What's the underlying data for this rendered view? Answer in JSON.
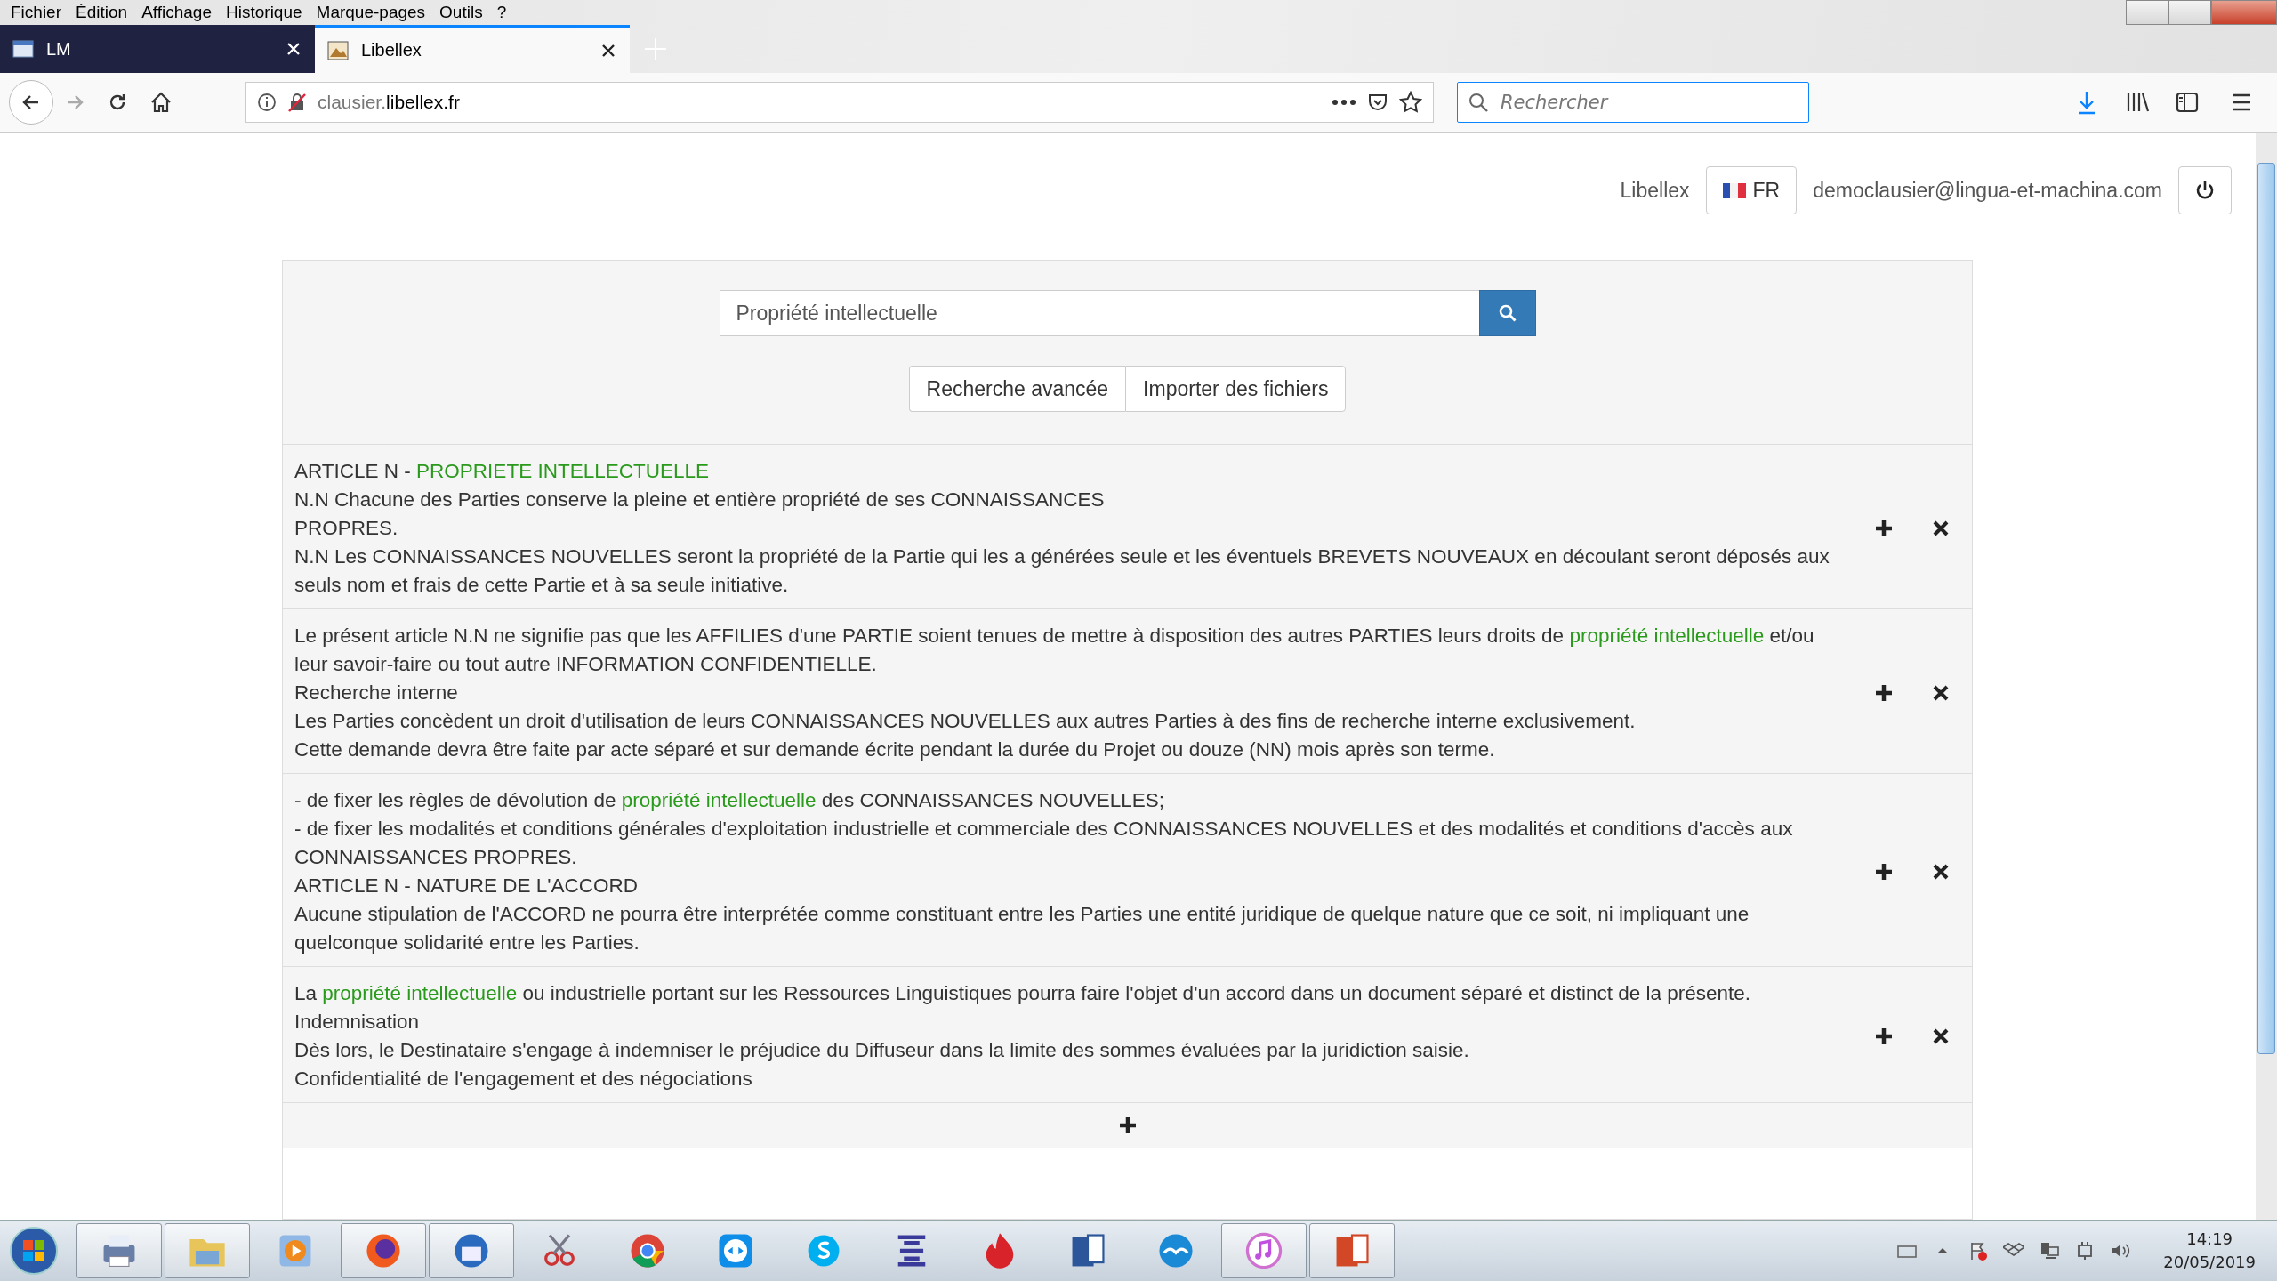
{
  "menu_bar": [
    "Fichier",
    "Édition",
    "Affichage",
    "Historique",
    "Marque-pages",
    "Outils",
    "?"
  ],
  "tabs": [
    {
      "label": "LM",
      "selected": false
    },
    {
      "label": "Libellex",
      "selected": true
    }
  ],
  "address_bar": {
    "subdomain": "clausier.",
    "domain": "libellex.fr"
  },
  "search_bar": {
    "placeholder": "Rechercher"
  },
  "header": {
    "brand": "Libellex",
    "language": "FR",
    "user": "democlausier@lingua-et-machina.com"
  },
  "search": {
    "value": "Propriété intellectuelle"
  },
  "actions": [
    "Recherche avancée",
    "Importer des fichiers"
  ],
  "results": [
    {
      "lines": [
        [
          {
            "text": "ARTICLE N - ",
            "highlight": false
          },
          {
            "text": "PROPRIETE INTELLECTUELLE",
            "highlight": true
          }
        ],
        [
          {
            "text": "N.N Chacune des Parties conserve la pleine et entière propriété de ses CONNAISSANCES",
            "highlight": false
          }
        ],
        [
          {
            "text": "PROPRES.",
            "highlight": false
          }
        ],
        [
          {
            "text": "N.N Les CONNAISSANCES NOUVELLES seront la propriété de la Partie qui les a générées seule et les éventuels BREVETS NOUVEAUX en découlant seront déposés aux seuls nom et frais de cette Partie et à sa seule initiative.",
            "highlight": false
          }
        ]
      ]
    },
    {
      "lines": [
        [
          {
            "text": "Le présent article N.N ne signifie pas que les AFFILIES d'une PARTIE soient tenues de mettre à disposition des autres PARTIES leurs droits de ",
            "highlight": false
          },
          {
            "text": "propriété intellectuelle",
            "highlight": true
          },
          {
            "text": " et/ou leur savoir-faire ou tout autre INFORMATION CONFIDENTIELLE.",
            "highlight": false
          }
        ],
        [
          {
            "text": "Recherche interne",
            "highlight": false
          }
        ],
        [
          {
            "text": "Les Parties concèdent un droit d'utilisation de leurs CONNAISSANCES NOUVELLES aux autres Parties à des fins de recherche interne exclusivement.",
            "highlight": false
          }
        ],
        [
          {
            "text": "Cette demande devra être faite par acte séparé et sur demande écrite pendant la durée du Projet ou douze (NN) mois après son terme.",
            "highlight": false
          }
        ]
      ]
    },
    {
      "lines": [
        [
          {
            "text": "- de fixer les règles de dévolution de ",
            "highlight": false
          },
          {
            "text": "propriété intellectuelle",
            "highlight": true
          },
          {
            "text": " des CONNAISSANCES NOUVELLES;",
            "highlight": false
          }
        ],
        [
          {
            "text": "- de fixer les modalités et conditions générales d'exploitation industrielle et commerciale des CONNAISSANCES NOUVELLES et des modalités et conditions d'accès aux CONNAISSANCES PROPRES.",
            "highlight": false
          }
        ],
        [
          {
            "text": "ARTICLE N - NATURE DE L'ACCORD",
            "highlight": false
          }
        ],
        [
          {
            "text": "Aucune stipulation de l'ACCORD ne pourra être interprétée comme constituant entre les Parties une entité juridique de quelque nature que ce soit, ni impliquant une quelconque solidarité entre les Parties.",
            "highlight": false
          }
        ]
      ]
    },
    {
      "lines": [
        [
          {
            "text": "La ",
            "highlight": false
          },
          {
            "text": "propriété intellectuelle",
            "highlight": true
          },
          {
            "text": " ou industrielle portant sur les Ressources Linguistiques pourra faire l'objet d'un accord dans un document séparé et distinct de la présente.",
            "highlight": false
          }
        ],
        [
          {
            "text": "Indemnisation",
            "highlight": false
          }
        ],
        [
          {
            "text": "Dès lors, le Destinataire s'engage à indemniser le préjudice du Diffuseur dans la limite des sommes évaluées par la juridiction saisie.",
            "highlight": false
          }
        ],
        [
          {
            "text": "Confidentialité de l'engagement et des négociations",
            "highlight": false
          }
        ]
      ]
    }
  ],
  "taskbar": [
    {
      "open": true
    },
    {
      "open": true
    },
    {
      "open": false
    },
    {
      "open": true
    },
    {
      "open": true
    },
    {
      "open": false
    },
    {
      "open": false
    },
    {
      "open": false
    },
    {
      "open": false
    },
    {
      "open": false
    },
    {
      "open": false
    },
    {
      "open": false
    },
    {
      "open": false
    },
    {
      "open": true
    },
    {
      "open": true
    }
  ],
  "clock": {
    "time": "14:19",
    "date": "20/05/2019"
  }
}
